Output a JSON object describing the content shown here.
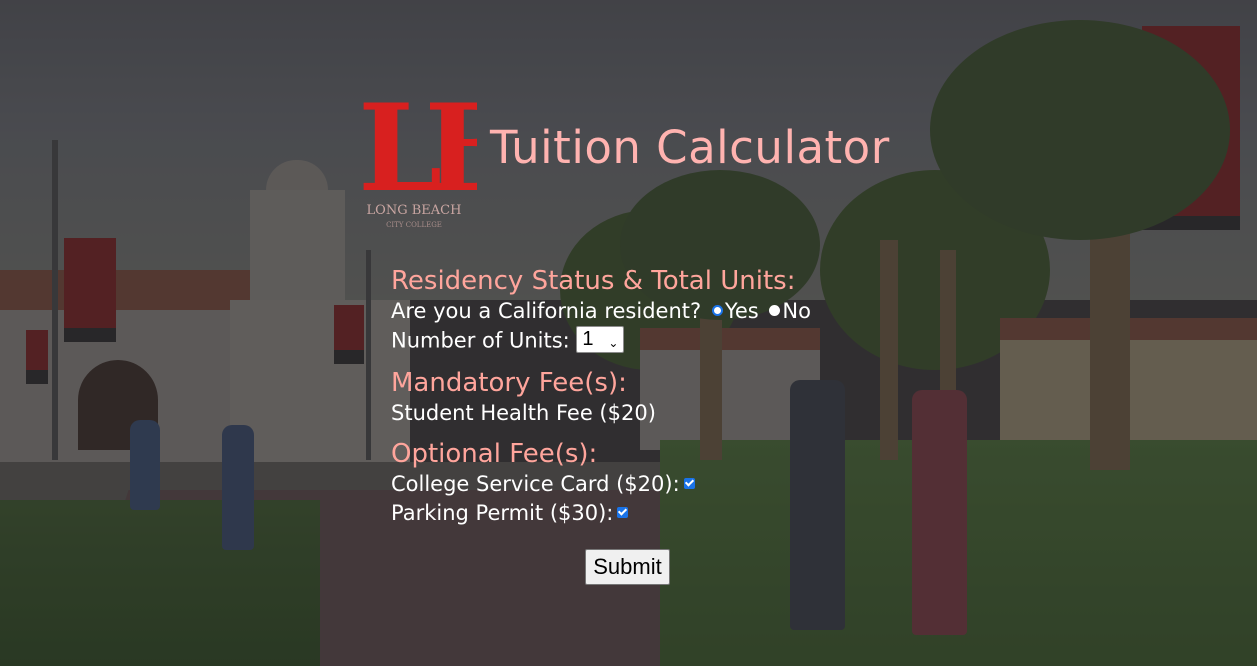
{
  "header": {
    "logo_text": "LB",
    "logo_caption": "LONG BEACH",
    "logo_subcaption": "CITY COLLEGE",
    "title": "Tuition Calculator"
  },
  "residency": {
    "heading": "Residency Status & Total Units:",
    "question": "Are you a California resident?",
    "options": [
      "Yes",
      "No"
    ],
    "selected": "Yes",
    "units_label": "Number of Units:",
    "units_value": "1"
  },
  "mandatory": {
    "heading": "Mandatory Fee(s):",
    "fee": "Student Health Fee ($20)"
  },
  "optional": {
    "heading": "Optional Fee(s):",
    "fees": [
      {
        "label": "College Service Card ($20):",
        "checked": true
      },
      {
        "label": "Parking Permit ($30):",
        "checked": true
      }
    ]
  },
  "submit_label": "Submit",
  "colors": {
    "title": "#ffb3b0",
    "heading": "#ffa59c",
    "logo_red": "#d8201f",
    "accent": "#1a73e8"
  }
}
